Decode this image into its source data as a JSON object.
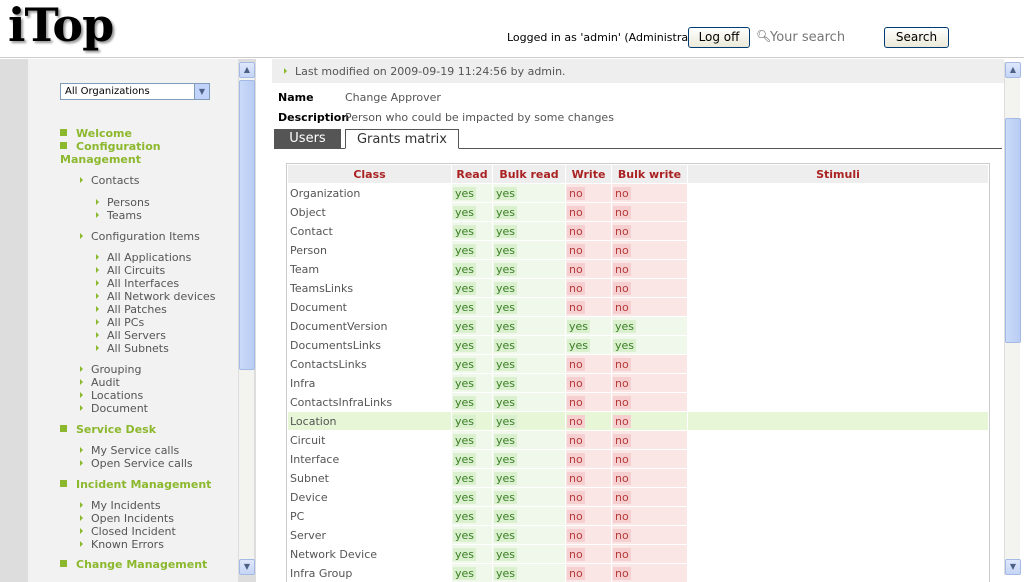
{
  "header": {
    "logo": "iTop",
    "login_text": "Logged in as 'admin' (Administrator)",
    "logoff_label": "Log off",
    "search_placeholder": "Your search",
    "search_label": "Search"
  },
  "menu": {
    "org_select": "All Organizations",
    "items": [
      {
        "type": "h",
        "label": "Welcome"
      },
      {
        "type": "h",
        "label": "Configuration Management"
      },
      {
        "type": "i1",
        "label": "Contacts"
      },
      {
        "type": "i2",
        "label": "Persons"
      },
      {
        "type": "i2",
        "label": "Teams"
      },
      {
        "type": "i1",
        "label": "Configuration Items"
      },
      {
        "type": "i2",
        "label": "All Applications"
      },
      {
        "type": "i2",
        "label": "All Circuits"
      },
      {
        "type": "i2",
        "label": "All Interfaces"
      },
      {
        "type": "i2",
        "label": "All Network devices"
      },
      {
        "type": "i2",
        "label": "All Patches"
      },
      {
        "type": "i2",
        "label": "All PCs"
      },
      {
        "type": "i2",
        "label": "All Servers"
      },
      {
        "type": "i2",
        "label": "All Subnets"
      },
      {
        "type": "i1",
        "label": "Grouping"
      },
      {
        "type": "i1",
        "label": "Audit"
      },
      {
        "type": "i1",
        "label": "Locations"
      },
      {
        "type": "i1",
        "label": "Document"
      },
      {
        "type": "h",
        "label": "Service Desk"
      },
      {
        "type": "i1",
        "label": "My Service calls"
      },
      {
        "type": "i1",
        "label": "Open Service calls"
      },
      {
        "type": "h",
        "label": "Incident Management"
      },
      {
        "type": "i1",
        "label": "My Incidents"
      },
      {
        "type": "i1",
        "label": "Open Incidents"
      },
      {
        "type": "i1",
        "label": "Closed Incident"
      },
      {
        "type": "i1",
        "label": "Known Errors"
      },
      {
        "type": "h",
        "label": "Change Management"
      }
    ]
  },
  "main": {
    "last_modified": "Last modified on 2009-09-19 11:24:56 by admin.",
    "name_label": "Name",
    "name_value": "Change Approver",
    "description_label": "Description",
    "description_value": "Person who could be impacted by some changes",
    "tabs": [
      "Users",
      "Grants matrix"
    ],
    "columns": [
      "Class",
      "Read",
      "Bulk read",
      "Write",
      "Bulk write",
      "Stimuli"
    ],
    "rows": [
      [
        "Organization",
        "yes",
        "yes",
        "no",
        "no",
        ""
      ],
      [
        "Object",
        "yes",
        "yes",
        "no",
        "no",
        ""
      ],
      [
        "Contact",
        "yes",
        "yes",
        "no",
        "no",
        ""
      ],
      [
        "Person",
        "yes",
        "yes",
        "no",
        "no",
        ""
      ],
      [
        "Team",
        "yes",
        "yes",
        "no",
        "no",
        ""
      ],
      [
        "TeamsLinks",
        "yes",
        "yes",
        "no",
        "no",
        ""
      ],
      [
        "Document",
        "yes",
        "yes",
        "no",
        "no",
        ""
      ],
      [
        "DocumentVersion",
        "yes",
        "yes",
        "yes",
        "yes",
        ""
      ],
      [
        "DocumentsLinks",
        "yes",
        "yes",
        "yes",
        "yes",
        ""
      ],
      [
        "ContactsLinks",
        "yes",
        "yes",
        "no",
        "no",
        ""
      ],
      [
        "Infra",
        "yes",
        "yes",
        "no",
        "no",
        ""
      ],
      [
        "ContactsInfraLinks",
        "yes",
        "yes",
        "no",
        "no",
        ""
      ],
      [
        "Location",
        "yes",
        "yes",
        "no",
        "no",
        ""
      ],
      [
        "Circuit",
        "yes",
        "yes",
        "no",
        "no",
        ""
      ],
      [
        "Interface",
        "yes",
        "yes",
        "no",
        "no",
        ""
      ],
      [
        "Subnet",
        "yes",
        "yes",
        "no",
        "no",
        ""
      ],
      [
        "Device",
        "yes",
        "yes",
        "no",
        "no",
        ""
      ],
      [
        "PC",
        "yes",
        "yes",
        "no",
        "no",
        ""
      ],
      [
        "Server",
        "yes",
        "yes",
        "no",
        "no",
        ""
      ],
      [
        "Network Device",
        "yes",
        "yes",
        "no",
        "no",
        ""
      ],
      [
        "Infra Group",
        "yes",
        "yes",
        "no",
        "no",
        ""
      ]
    ],
    "highlighted_row": "Location"
  },
  "colors": {
    "menu_heading": "#8cb82d",
    "column_header": "#a22222",
    "yes": "#3a7d24",
    "no": "#b53a3a"
  }
}
